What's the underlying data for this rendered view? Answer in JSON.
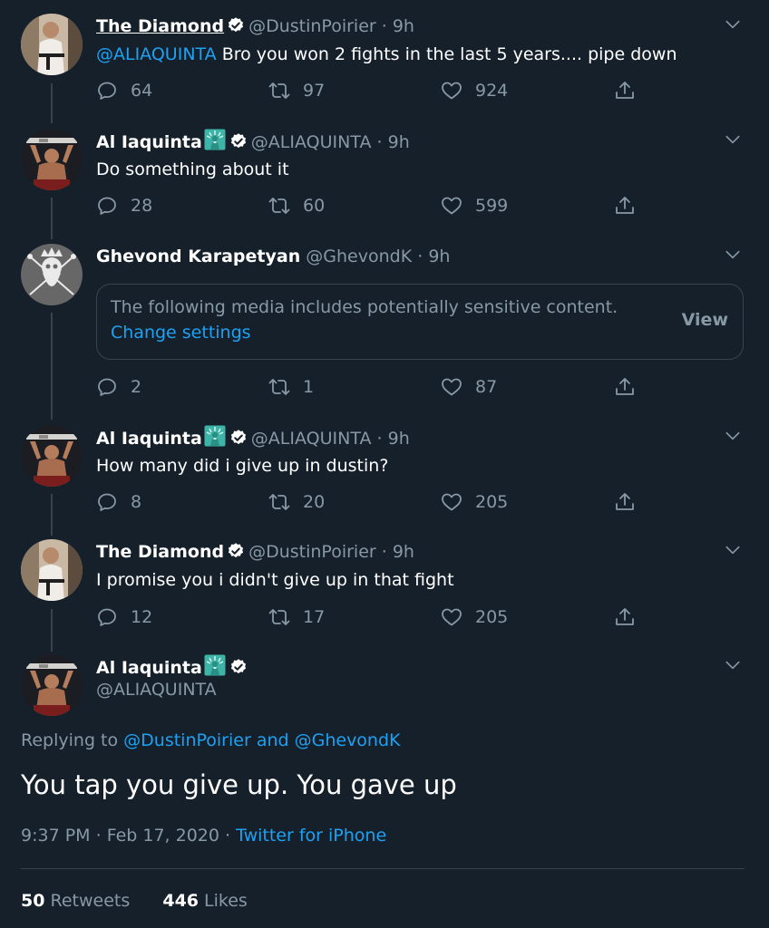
{
  "tweets": [
    {
      "name": "The Diamond",
      "handle": "@DustinPoirier",
      "sep": "·",
      "time": "9h",
      "mention": "@ALIAQUINTA",
      "text": " Bro you won 2 fights in the last 5 years.... pipe down",
      "replies": "64",
      "retweets": "97",
      "likes": "924"
    },
    {
      "name": "Al Iaquinta",
      "handle": "@ALIAQUINTA",
      "sep": "·",
      "time": "9h",
      "text": "Do something about it",
      "replies": "28",
      "retweets": "60",
      "likes": "599"
    },
    {
      "name": "Ghevond Karapetyan",
      "handle": "@GhevondK",
      "sep": "·",
      "time": "9h",
      "sensitive_notice": "The following media includes potentially sensitive content.",
      "change_settings": "Change settings",
      "view_label": "View",
      "replies": "2",
      "retweets": "1",
      "likes": "87"
    },
    {
      "name": "Al Iaquinta",
      "handle": "@ALIAQUINTA",
      "sep": "·",
      "time": "9h",
      "text": "How many did i give up in dustin?",
      "replies": "8",
      "retweets": "20",
      "likes": "205"
    },
    {
      "name": "The Diamond",
      "handle": "@DustinPoirier",
      "sep": "·",
      "time": "9h",
      "text": "I promise you i didn't give up in that fight",
      "replies": "12",
      "retweets": "17",
      "likes": "205"
    }
  ],
  "main": {
    "name": "Al Iaquinta",
    "handle": "@ALIAQUINTA",
    "replying_prefix": "Replying to ",
    "reply_user1": "@DustinPoirier",
    "reply_and": " and ",
    "reply_user2": "@GhevondK",
    "text": "You tap you give up. You gave up",
    "time": "9:37 PM",
    "sep": " · ",
    "date": "Feb 17, 2020",
    "source": "Twitter for iPhone",
    "retweet_count": "50",
    "retweet_label": " Retweets",
    "like_count": "446",
    "like_label": " Likes"
  },
  "colors": {
    "background": "#15202b",
    "link": "#1da1f2",
    "muted": "#8899a6",
    "border": "#38444d"
  },
  "icons": [
    "reply-icon",
    "retweet-icon",
    "like-icon",
    "share-icon",
    "verified-badge-icon",
    "statue-of-liberty-icon",
    "chevron-down-icon"
  ]
}
